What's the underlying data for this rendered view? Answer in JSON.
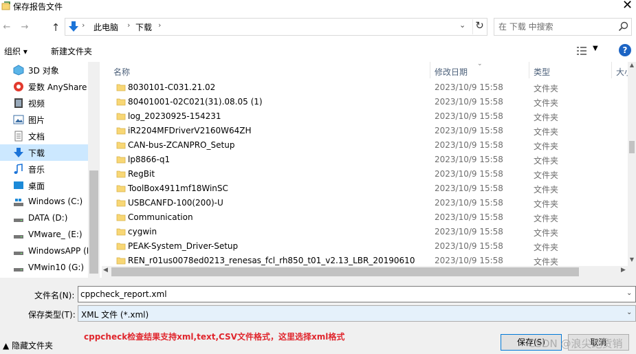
{
  "window": {
    "title": "保存报告文件",
    "close_glyph": "✕"
  },
  "nav": {
    "back_glyph": "←",
    "forward_glyph": "→",
    "up_glyph": "↑",
    "breadcrumbs": [
      "此电脑",
      "下载"
    ],
    "separator": "›",
    "dropdown_glyph": "⌄",
    "refresh_glyph": "↻"
  },
  "search": {
    "placeholder": "在 下载 中搜索"
  },
  "toolbar": {
    "organize_label": "组织 ▾",
    "new_folder_label": "新建文件夹",
    "view_dropdown_glyph": "▼",
    "help_label": "?"
  },
  "sidebar": {
    "items": [
      {
        "label": "3D 对象",
        "icon": "3d-objects-icon"
      },
      {
        "label": "爱数 AnyShare",
        "icon": "anyshare-icon"
      },
      {
        "label": "视频",
        "icon": "video-icon"
      },
      {
        "label": "图片",
        "icon": "pictures-icon"
      },
      {
        "label": "文档",
        "icon": "documents-icon"
      },
      {
        "label": "下载",
        "icon": "download-icon",
        "selected": true
      },
      {
        "label": "音乐",
        "icon": "music-icon"
      },
      {
        "label": "桌面",
        "icon": "desktop-icon"
      },
      {
        "label": "Windows (C:)",
        "icon": "windows-drive-icon"
      },
      {
        "label": "DATA (D:)",
        "icon": "drive-icon"
      },
      {
        "label": "VMware_ (E:)",
        "icon": "drive-icon"
      },
      {
        "label": "WindowsAPP (F",
        "icon": "drive-icon"
      },
      {
        "label": "VMwin10 (G:)",
        "icon": "drive-icon"
      }
    ]
  },
  "columns": {
    "name": "名称",
    "date": "修改日期",
    "type": "类型",
    "size": "大小",
    "sort_glyph": "⌄"
  },
  "files": [
    {
      "name": "8030101-C031.21.02",
      "date": "2023/10/9 15:58",
      "type": "文件夹"
    },
    {
      "name": "80401001-02C021(31).08.05 (1)",
      "date": "2023/10/9 15:58",
      "type": "文件夹"
    },
    {
      "name": "log_20230925-154231",
      "date": "2023/10/9 15:58",
      "type": "文件夹"
    },
    {
      "name": "iR2204MFDriverV2160W64ZH",
      "date": "2023/10/9 15:58",
      "type": "文件夹"
    },
    {
      "name": "CAN-bus-ZCANPRO_Setup",
      "date": "2023/10/9 15:58",
      "type": "文件夹"
    },
    {
      "name": "lp8866-q1",
      "date": "2023/10/9 15:58",
      "type": "文件夹"
    },
    {
      "name": "RegBit",
      "date": "2023/10/9 15:58",
      "type": "文件夹"
    },
    {
      "name": "ToolBox4911mf18WinSC",
      "date": "2023/10/9 15:58",
      "type": "文件夹"
    },
    {
      "name": "USBCANFD-100(200)-U",
      "date": "2023/10/9 15:58",
      "type": "文件夹"
    },
    {
      "name": "Communication",
      "date": "2023/10/9 15:58",
      "type": "文件夹"
    },
    {
      "name": "cygwin",
      "date": "2023/10/9 15:58",
      "type": "文件夹"
    },
    {
      "name": "PEAK-System_Driver-Setup",
      "date": "2023/10/9 15:58",
      "type": "文件夹"
    },
    {
      "name": "REN_r01us0078ed0213_renesas_fcl_rh850_t01_v2.13_LBR_20190610",
      "date": "2023/10/9 15:58",
      "type": "文件夹"
    }
  ],
  "scroll": {
    "up_glyph": "▲",
    "down_glyph": "▼",
    "left_glyph": "◀",
    "right_glyph": "▶"
  },
  "form": {
    "filename_label": "文件名(N):",
    "filename_value": "cppcheck_report.xml",
    "filetype_label": "保存类型(T):",
    "filetype_value": "XML 文件 (*.xml)",
    "dropdown_glyph": "⌄"
  },
  "annotation": "cppcheck检查结果支持xml,text,CSV文件格式，这里选择xml格式",
  "footer": {
    "hide_folders_label": "▲ 隐藏文件夹",
    "save_label": "保存(S)",
    "cancel_label": "取消",
    "watermark": "CSDN @浪尖跑货销"
  },
  "colors": {
    "selection": "#cce8ff",
    "annotation": "#e0262d",
    "folder": "#f8d775",
    "accent": "#0078d7"
  }
}
